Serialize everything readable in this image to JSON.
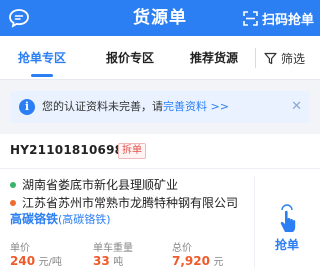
{
  "header": {
    "title": "货源单",
    "scan_label": "扫码抢单",
    "message_icon": "message-icon",
    "scan_icon": "scan-icon",
    "bg_color": "#2b7ff3"
  },
  "tabs": [
    {
      "label": "抢单专区",
      "active": true
    },
    {
      "label": "报价专区",
      "active": false
    },
    {
      "label": "推荐货源",
      "active": false
    }
  ],
  "filter": {
    "label": "筛选",
    "icon": "filter-icon"
  },
  "notice": {
    "text": "您的认证资料未完善，请",
    "link": "完善资料 >>",
    "icon": "info-icon",
    "close_icon": "close-icon"
  },
  "order": {
    "id": "HY21101810698​0",
    "badge": "拆单",
    "from": "湖南省娄底市新化县理顺矿业",
    "to": "江苏省苏州市常熟市龙腾特种钢有限公司",
    "goods": "高碳铬铁",
    "goods_sub": "(高碳铬铁)",
    "stats": [
      {
        "label": "单价",
        "value": "240",
        "unit": "元/吨"
      },
      {
        "label": "单车重量",
        "value": "33",
        "unit": "吨"
      },
      {
        "label": "总价",
        "value": "7,920",
        "unit": "元"
      }
    ],
    "grab_label": "抢单",
    "grab_icon": "hand-tap-icon",
    "from_dot_color": "#3ab36b",
    "to_dot_color": "#ef6b2f",
    "value_color": "#ef5a2a"
  }
}
